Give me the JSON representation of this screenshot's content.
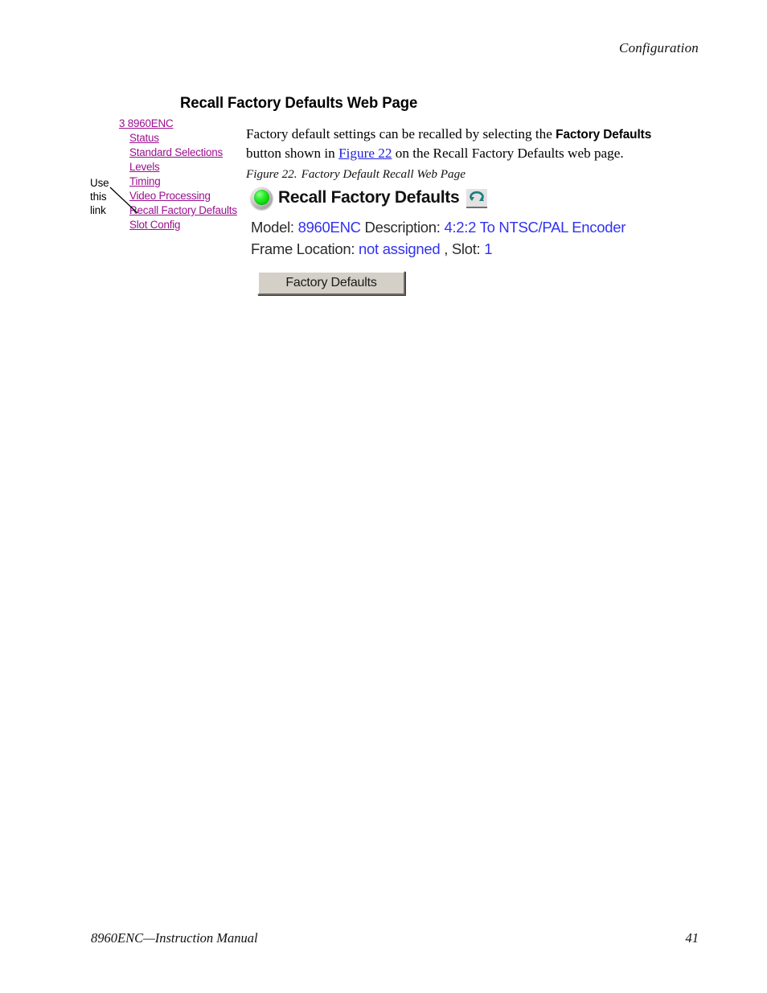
{
  "page": {
    "running_head": "Configuration",
    "footer_left": "8960ENC—Instruction Manual",
    "footer_page_number": "41"
  },
  "section": {
    "heading": "Recall Factory Defaults Web Page"
  },
  "paragraph": {
    "part1": "Factory default settings can be recalled by selecting the ",
    "bold_ui_term": "Factory Defaults",
    "part2": " button shown in ",
    "xref": "Figure 22",
    "part3": " on the Recall Factory Defaults web page."
  },
  "figure_caption": {
    "number": "Figure 22.",
    "title": "Factory Default Recall Web Page"
  },
  "nav_panel": {
    "items": [
      {
        "label": "3 8960ENC",
        "level": "root"
      },
      {
        "label": "Status",
        "level": "child"
      },
      {
        "label": "Standard Selections",
        "level": "child"
      },
      {
        "label": "Levels",
        "level": "child"
      },
      {
        "label": "Timing",
        "level": "child"
      },
      {
        "label": "Video Processing",
        "level": "child"
      },
      {
        "label": "Recall Factory Defaults",
        "level": "child"
      },
      {
        "label": "Slot Config",
        "level": "child"
      }
    ],
    "link_color": "#9b0f8f"
  },
  "callout": {
    "line1": "Use",
    "line2": "this",
    "line3": "link"
  },
  "web_figure": {
    "status_led": "green-status-led-icon",
    "title": "Recall Factory Defaults",
    "refresh_icon": "refresh-icon",
    "model_label": "Model:",
    "model_value": "8960ENC",
    "description_label": "Description:",
    "description_value": "4:2:2 To NTSC/PAL Encoder",
    "frame_location_label": "Frame Location:",
    "frame_location_value": "not assigned",
    "slot_separator": ", ",
    "slot_label": "Slot:",
    "slot_value": "1",
    "button_label": "Factory Defaults",
    "value_color": "#3232f0",
    "led_color": "#0bd80b"
  }
}
